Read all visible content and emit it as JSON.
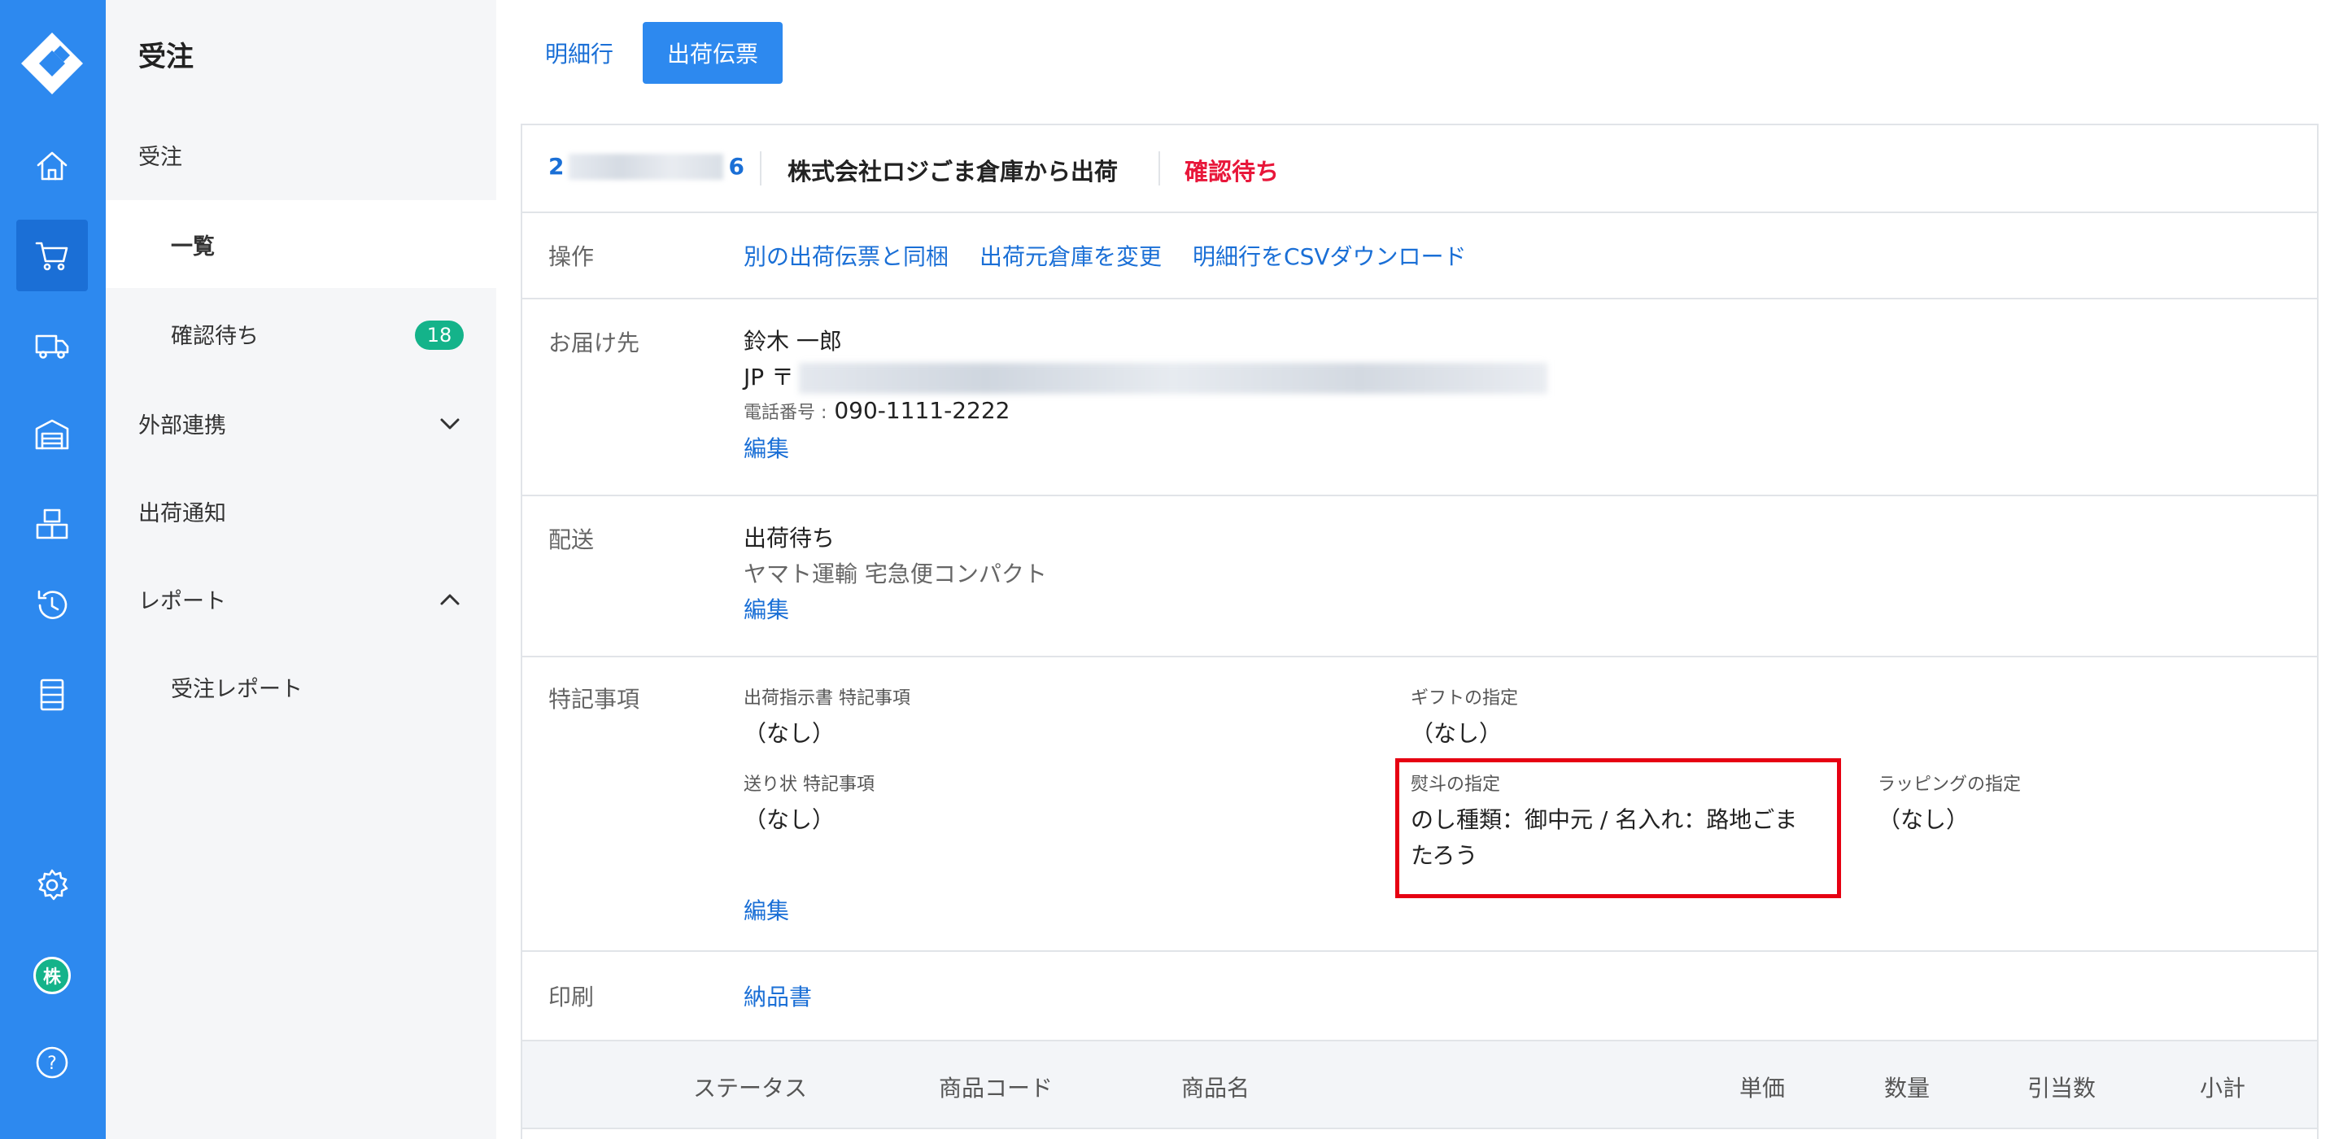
{
  "rail": {
    "icons": [
      "logo-icon",
      "home-icon",
      "cart-icon",
      "truck-icon",
      "warehouse-icon",
      "boxes-icon",
      "history-icon",
      "list-icon",
      "gear-icon",
      "help-icon"
    ],
    "avatar_label": "株",
    "help_label": "?"
  },
  "subnav": {
    "title": "受注",
    "items": [
      {
        "label": "受注"
      },
      {
        "label": "一覧"
      },
      {
        "label": "確認待ち",
        "badge": "18"
      },
      {
        "label": "外部連携"
      },
      {
        "label": "出荷通知"
      },
      {
        "label": "レポート"
      },
      {
        "label": "受注レポート"
      }
    ]
  },
  "tabs": [
    {
      "label": "明細行"
    },
    {
      "label": "出荷伝票"
    }
  ],
  "header": {
    "id_prefix": "2",
    "id_suffix": "6",
    "warehouse": "株式会社ロジごま倉庫から出荷",
    "status": "確認待ち"
  },
  "operations": {
    "label": "操作",
    "links": [
      "別の出荷伝票と同梱",
      "出荷元倉庫を変更",
      "明細行をCSVダウンロード"
    ]
  },
  "destination": {
    "label": "お届け先",
    "name": "鈴木 一郎",
    "address_prefix": "JP 〒",
    "phone_label": "電話番号 :",
    "phone": "090-1111-2222",
    "edit": "編集"
  },
  "delivery": {
    "label": "配送",
    "status": "出荷待ち",
    "method": "ヤマト運輸 宅急便コンパクト",
    "edit": "編集"
  },
  "notes": {
    "label": "特記事項",
    "shipping_instruction_label": "出荷指示書 特記事項",
    "shipping_instruction_value": "（なし）",
    "gift_label": "ギフトの指定",
    "gift_value": "（なし）",
    "invoice_label": "送り状 特記事項",
    "invoice_value": "（なし）",
    "noshi_label": "熨斗の指定",
    "noshi_line1": "のし種類：御中元 / 名入れ：路地ごま",
    "noshi_line2": "たろう",
    "wrapping_label": "ラッピングの指定",
    "wrapping_value": "（なし）",
    "edit": "編集",
    "highlight_color": "#e60012"
  },
  "print": {
    "label": "印刷",
    "link": "納品書"
  },
  "table": {
    "columns": [
      "ステータス",
      "商品コード",
      "商品名",
      "単価",
      "数量",
      "引当数",
      "小計"
    ]
  },
  "colors": {
    "rail": "#2d89ef",
    "accent": "#1a6fd6",
    "badge": "#14b38a",
    "status_red": "#e8173a"
  }
}
